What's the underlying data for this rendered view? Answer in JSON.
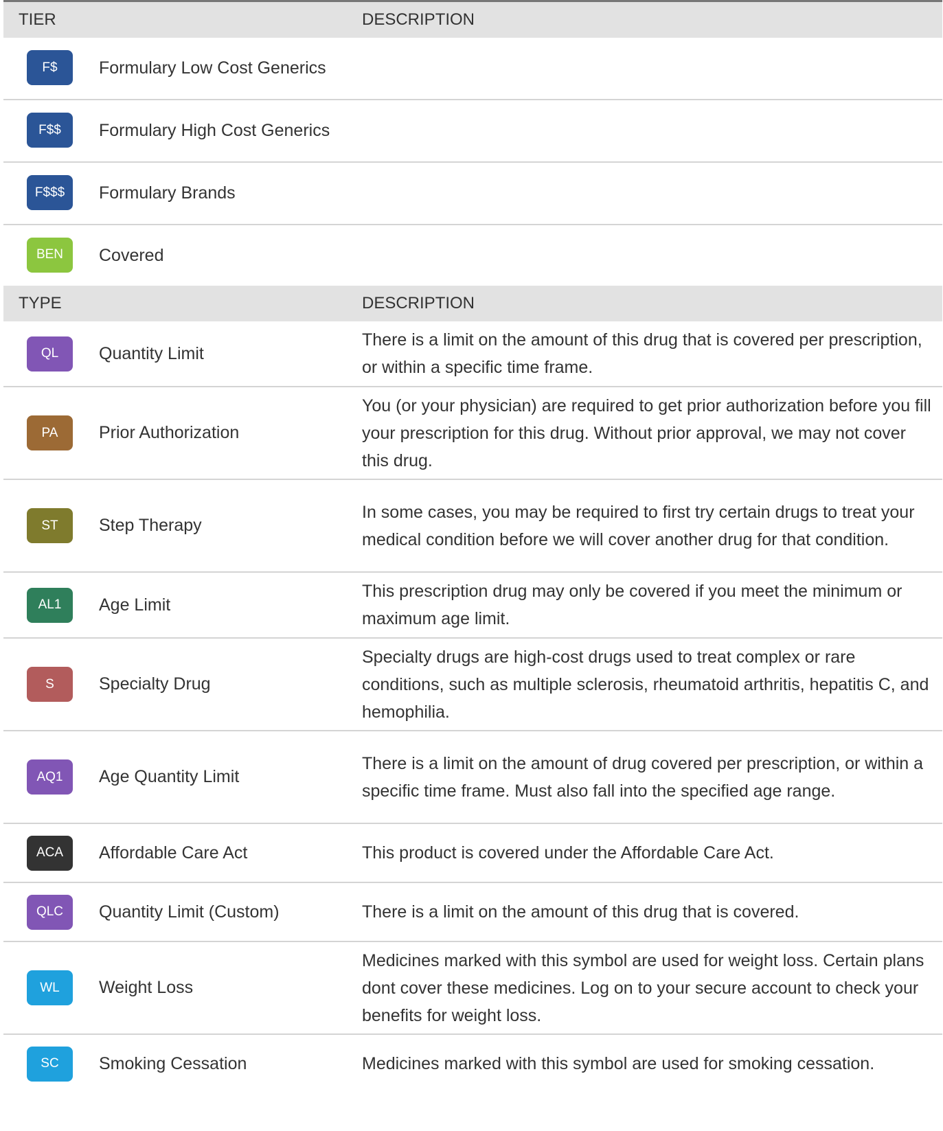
{
  "tier_section": {
    "header": {
      "col1": "TIER",
      "col2": "DESCRIPTION"
    },
    "rows": [
      {
        "badge": "F$",
        "color": "#2b5597",
        "name": "Formulary Low Cost Generics"
      },
      {
        "badge": "F$$",
        "color": "#2b5597",
        "name": "Formulary High Cost Generics"
      },
      {
        "badge": "F$$$",
        "color": "#2b5597",
        "name": "Formulary Brands"
      },
      {
        "badge": "BEN",
        "color": "#8cc63f",
        "name": "Covered"
      }
    ]
  },
  "type_section": {
    "header": {
      "col1": "TYPE",
      "col2": "DESCRIPTION"
    },
    "rows": [
      {
        "badge": "QL",
        "color": "#8156b5",
        "name": "Quantity Limit",
        "description": "There is a limit on the amount of this drug that is covered per prescription, or within a specific time frame."
      },
      {
        "badge": "PA",
        "color": "#9c6a35",
        "name": "Prior Authorization",
        "description": "You (or your physician) are required to get prior authorization before you fill your prescription for this drug. Without prior approval, we may not cover this drug."
      },
      {
        "badge": "ST",
        "color": "#7f7b2d",
        "name": "Step Therapy",
        "description": "In some cases, you may be required to first try certain drugs to treat your medical condition before we will cover another drug for that condition."
      },
      {
        "badge": "AL1",
        "color": "#2f7f5b",
        "name": "Age Limit",
        "description": "This prescription drug may only be covered if you meet the minimum or maximum age limit."
      },
      {
        "badge": "S",
        "color": "#b25c5c",
        "name": "Specialty Drug",
        "description": "Specialty drugs are high-cost drugs used to treat complex or rare conditions, such as multiple sclerosis, rheumatoid arthritis, hepatitis C, and hemophilia."
      },
      {
        "badge": "AQ1",
        "color": "#8156b5",
        "name": "Age Quantity Limit",
        "description": "There is a limit on the amount of drug covered per prescription, or within a specific time frame.  Must also fall into the specified age range."
      },
      {
        "badge": "ACA",
        "color": "#333333",
        "name": "Affordable Care Act",
        "description": "This product is covered under the Affordable Care Act."
      },
      {
        "badge": "QLC",
        "color": "#8156b5",
        "name": "Quantity Limit (Custom)",
        "description": "There is a limit on the amount of this drug that is covered."
      },
      {
        "badge": "WL",
        "color": "#1fa1dd",
        "name": "Weight Loss",
        "description": "Medicines marked with this symbol are used for weight loss. Certain plans dont cover these medicines. Log on to your secure account to check your benefits for weight loss."
      },
      {
        "badge": "SC",
        "color": "#1fa1dd",
        "name": "Smoking Cessation",
        "description": "Medicines marked with this symbol are used for smoking cessation."
      }
    ]
  }
}
